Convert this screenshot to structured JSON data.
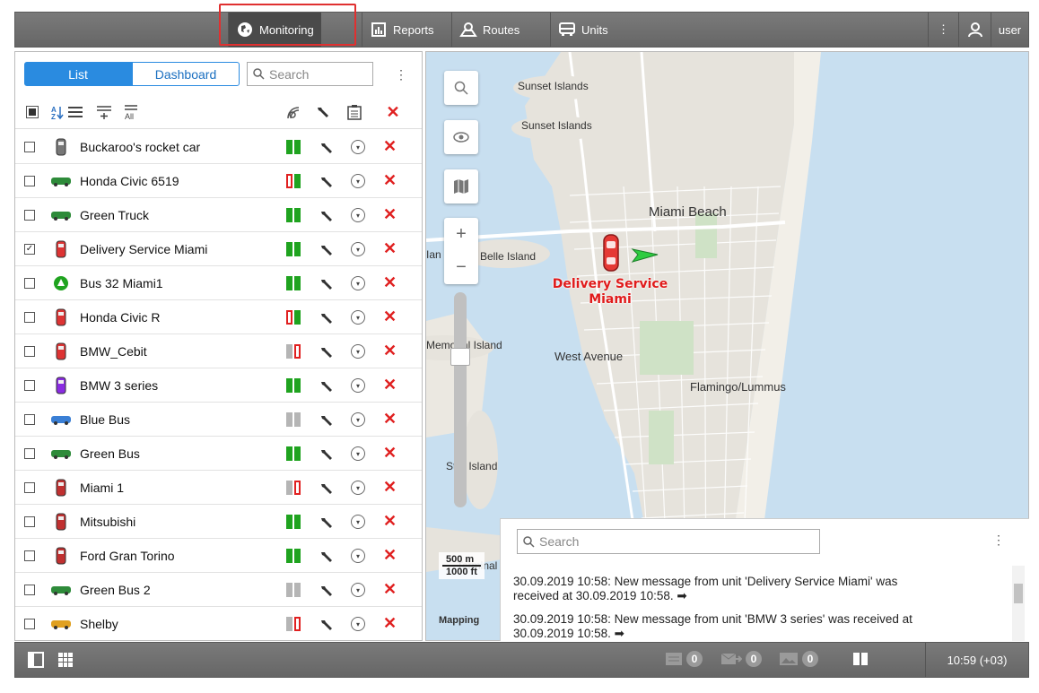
{
  "topnav": {
    "items": [
      {
        "label": "Monitoring",
        "icon": "globe-icon"
      },
      {
        "label": "Reports",
        "icon": "reports-icon"
      },
      {
        "label": "Routes",
        "icon": "routes-icon"
      },
      {
        "label": "Units",
        "icon": "bus-icon"
      }
    ],
    "more_label": "⋮",
    "user_label": "user"
  },
  "left": {
    "tab_list": "List",
    "tab_dashboard": "Dashboard",
    "search_placeholder": "Search",
    "units": [
      {
        "name": "Buckaroo's rocket car",
        "checked": false,
        "signal": "green"
      },
      {
        "name": "Honda Civic 6519",
        "checked": false,
        "signal": "red-green"
      },
      {
        "name": "Green Truck",
        "checked": false,
        "signal": "green"
      },
      {
        "name": "Delivery Service Miami",
        "checked": true,
        "signal": "green"
      },
      {
        "name": "Bus 32 Miami1",
        "checked": false,
        "signal": "green"
      },
      {
        "name": "Honda Civic R",
        "checked": false,
        "signal": "red-green"
      },
      {
        "name": "BMW_Cebit",
        "checked": false,
        "signal": "gray-red"
      },
      {
        "name": "BMW 3 series",
        "checked": false,
        "signal": "green"
      },
      {
        "name": "Blue Bus",
        "checked": false,
        "signal": "gray"
      },
      {
        "name": "Green Bus",
        "checked": false,
        "signal": "green"
      },
      {
        "name": "Miami 1",
        "checked": false,
        "signal": "gray-red"
      },
      {
        "name": "Mitsubishi",
        "checked": false,
        "signal": "green"
      },
      {
        "name": "Ford Gran Torino",
        "checked": false,
        "signal": "green"
      },
      {
        "name": "Green Bus 2",
        "checked": false,
        "signal": "gray"
      },
      {
        "name": "Shelby",
        "checked": false,
        "signal": "gray-red"
      }
    ]
  },
  "map": {
    "labels": {
      "sunset1": "Sunset Islands",
      "sunset2": "Sunset Islands",
      "miami_beach": "Miami Beach",
      "belle": "Belle Island",
      "memorial": "Memorial Island",
      "west_avenue": "West Avenue",
      "flamingo": "Flamingo/Lummus",
      "star": "Star Island",
      "terminal": "Terminal",
      "ian": "Ian"
    },
    "marker_name_line1": "Delivery Service",
    "marker_name_line2": "Miami",
    "scale_m": "500 m",
    "scale_ft": "1000 ft",
    "attribution": "Mapping"
  },
  "notifications": {
    "search_placeholder": "Search",
    "messages": [
      {
        "line1": "30.09.2019 10:58: New message from unit 'Delivery Service Miami' was",
        "line2": "received at 30.09.2019 10:58. ➡"
      },
      {
        "line1": "30.09.2019 10:58: New message from unit 'BMW 3 series' was received at",
        "line2": "30.09.2019 10:58. ➡"
      }
    ]
  },
  "bottom": {
    "messages_count": "0",
    "outbox_count": "0",
    "media_count": "0",
    "clock": "10:59 (+03)"
  },
  "colors": {
    "accent": "#2a8be0",
    "highlight": "#e03030",
    "signal_green": "#1fa31f",
    "signal_red": "#e02020",
    "signal_gray": "#b5b5b5"
  }
}
